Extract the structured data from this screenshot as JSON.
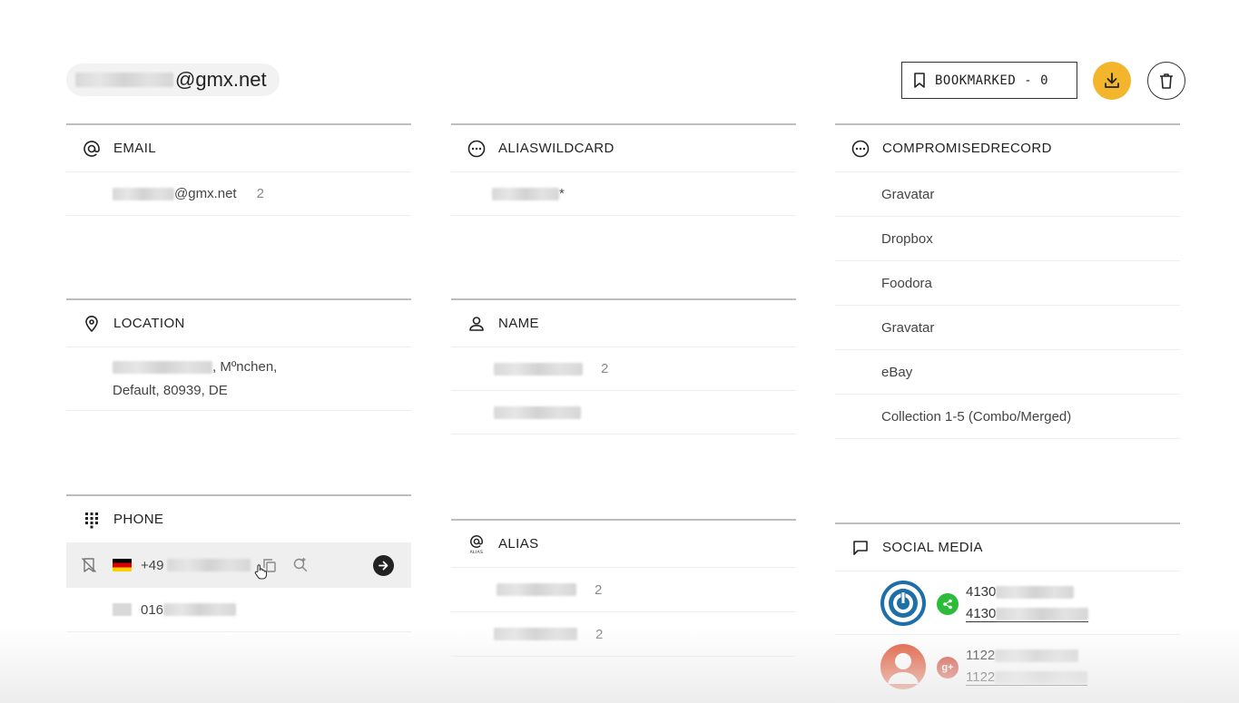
{
  "header": {
    "account_suffix": "@gmx.net",
    "bookmarked_label": "BOOKMARKED - 0"
  },
  "email": {
    "title": "EMAIL",
    "rows": [
      {
        "value": "@gmx.net",
        "count": "2"
      }
    ]
  },
  "aliaswildcard": {
    "title": "ALIASWILDCARD",
    "rows": [
      {
        "value": "*"
      }
    ]
  },
  "compromised": {
    "title": "COMPROMISEDRECORD",
    "rows": [
      "Gravatar",
      "Dropbox",
      "Foodora",
      "Gravatar",
      "eBay",
      "Collection 1-5 (Combo/Merged)"
    ]
  },
  "location": {
    "title": "LOCATION",
    "line1_suffix": ", Mºnchen,",
    "line2": "Default, 80939, DE"
  },
  "name": {
    "title": "NAME",
    "rows": [
      {
        "count": "2"
      },
      {
        "count": ""
      }
    ]
  },
  "phone": {
    "title": "PHONE",
    "rows": [
      {
        "prefix": "+49"
      },
      {
        "prefix": "016"
      }
    ]
  },
  "alias": {
    "title": "ALIAS",
    "rows": [
      {
        "count": "2"
      },
      {
        "count": "2"
      }
    ]
  },
  "social": {
    "title": "SOCIAL MEDIA",
    "rows": [
      {
        "id_prefix": "4130",
        "id2_prefix": "4130",
        "network_icon": "share-icon",
        "badge_color": "#2dbb3a"
      },
      {
        "id_prefix": "1122",
        "id2_prefix": "1122",
        "network_icon": "google-plus-icon",
        "badge_color": "#d34836"
      }
    ]
  },
  "colors": {
    "accent": "#f3b52c",
    "highlight_row": "#efefef"
  }
}
